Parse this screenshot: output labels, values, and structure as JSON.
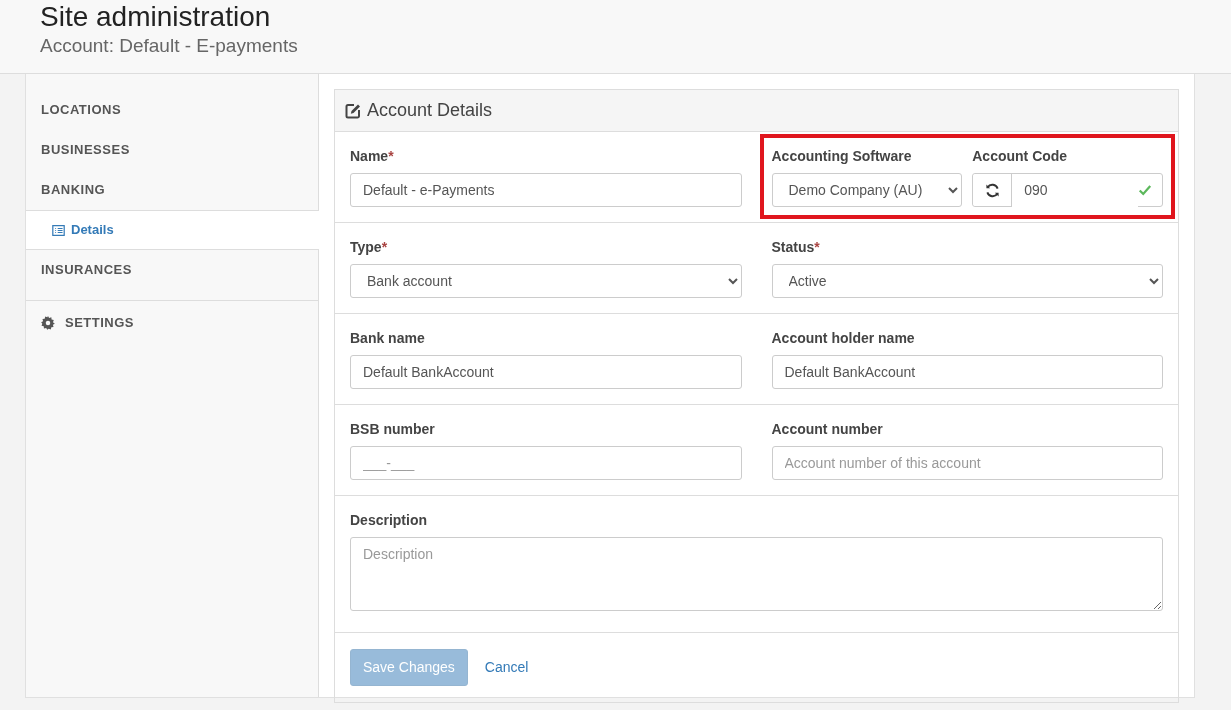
{
  "header": {
    "title": "Site administration",
    "subtitle": "Account: Default - E-payments"
  },
  "sidebar": {
    "items": [
      {
        "label": "LOCATIONS",
        "kind": "section",
        "selected": false
      },
      {
        "label": "BUSINESSES",
        "kind": "section",
        "selected": false
      },
      {
        "label": "BANKING",
        "kind": "section",
        "selected": false
      },
      {
        "label": "Details",
        "kind": "subitem",
        "selected": true
      },
      {
        "label": "INSURANCES",
        "kind": "section",
        "selected": false
      },
      {
        "label": "SETTINGS",
        "kind": "settings",
        "selected": false
      }
    ]
  },
  "panel": {
    "title": "Account Details",
    "rows": [
      [
        {
          "fields": [
            {
              "label": "Name",
              "required_mark": "*",
              "kind": "text",
              "value": "Default - e-Payments"
            }
          ]
        },
        {
          "highlighted": true,
          "fields": [
            {
              "label": "Accounting Software",
              "kind": "select",
              "value": "Demo Company (AU)"
            },
            {
              "label": "Account Code",
              "kind": "code",
              "value": "090",
              "valid": true
            }
          ]
        }
      ],
      [
        {
          "fields": [
            {
              "label": "Type",
              "required_mark": "*",
              "kind": "select",
              "value": "Bank account"
            }
          ]
        },
        {
          "fields": [
            {
              "label": "Status",
              "required_mark": "*",
              "kind": "select",
              "value": "Active"
            }
          ]
        }
      ],
      [
        {
          "fields": [
            {
              "label": "Bank name",
              "kind": "text",
              "value": "Default BankAccount"
            }
          ]
        },
        {
          "fields": [
            {
              "label": "Account holder name",
              "kind": "text",
              "value": "Default BankAccount"
            }
          ]
        }
      ],
      [
        {
          "fields": [
            {
              "label": "BSB number",
              "kind": "text",
              "placeholder": "___-___"
            }
          ]
        },
        {
          "fields": [
            {
              "label": "Account number",
              "kind": "text",
              "placeholder": "Account number of this account"
            }
          ]
        }
      ],
      [
        {
          "fields": [
            {
              "label": "Description",
              "kind": "textarea",
              "placeholder": "Description"
            }
          ]
        }
      ]
    ],
    "save": {
      "label": "Save Changes",
      "disabled": true
    },
    "cancel": {
      "label": "Cancel"
    }
  }
}
